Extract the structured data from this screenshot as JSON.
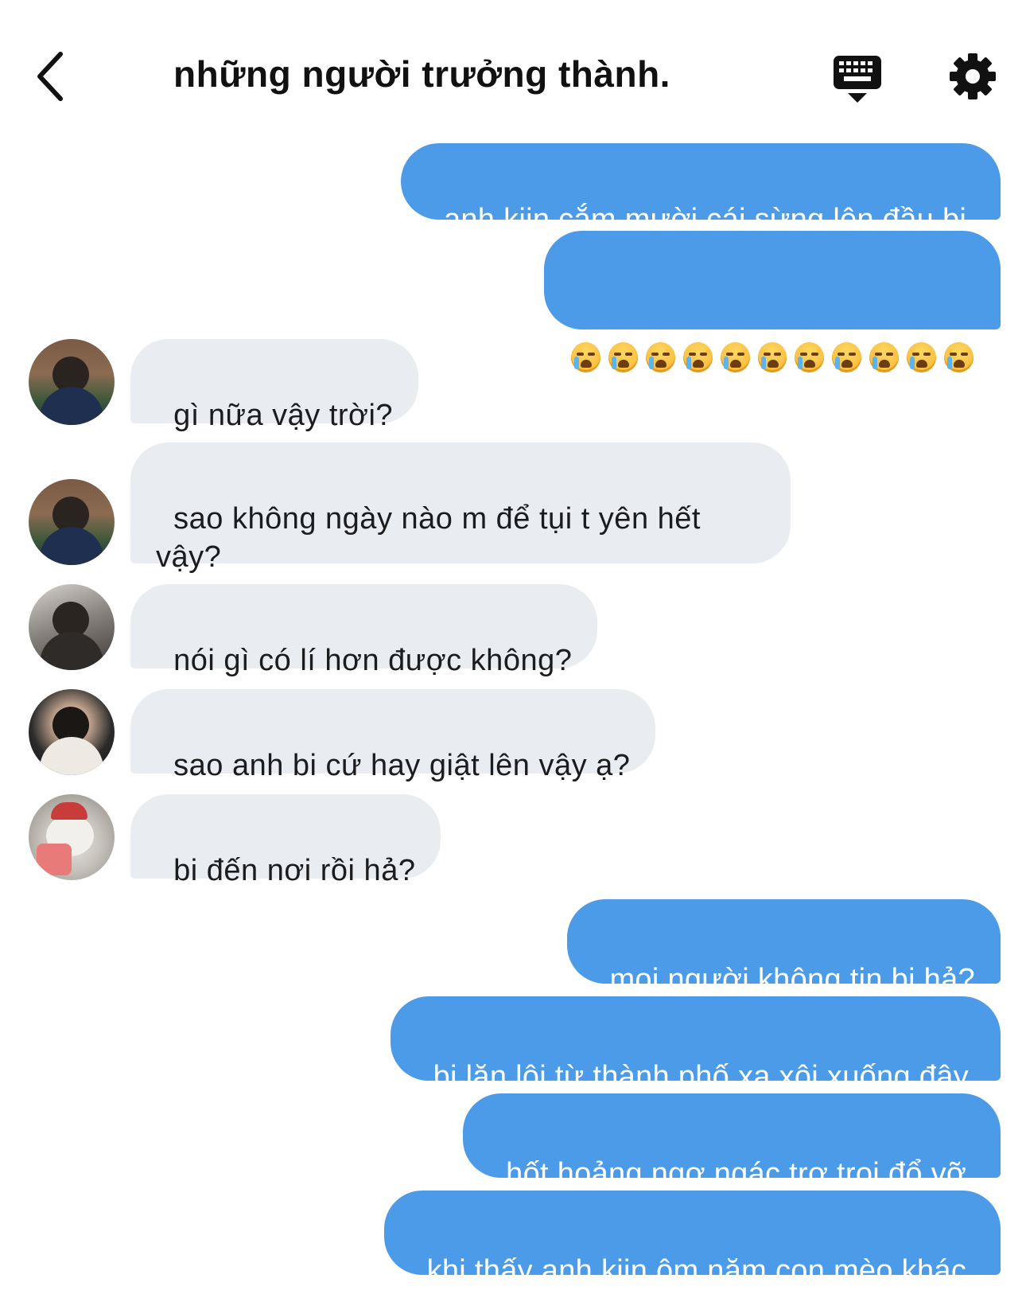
{
  "header": {
    "title": "những người trưởng thành."
  },
  "icons": {
    "back": "chevron-left-icon",
    "keyboard": "keyboard-icon",
    "settings": "gear-icon",
    "emoji": "loudly-crying-face-emoji"
  },
  "colors": {
    "outgoing_bubble": "#4c9be8",
    "incoming_bubble": "#e9edf1"
  },
  "messages": [
    {
      "direction": "out",
      "text": "anh kiin cắm mười cái sừng lên đầu bi."
    },
    {
      "direction": "out",
      "emoji": "😭",
      "emoji_count": 11
    },
    {
      "direction": "in",
      "text": "gì nữa vậy trời?"
    },
    {
      "direction": "in",
      "text": "sao không ngày nào m để tụi t yên hết vậy?"
    },
    {
      "direction": "in",
      "text": "nói gì có lí hơn được không?"
    },
    {
      "direction": "in",
      "text": "sao anh bi cứ hay giật lên vậy ạ?"
    },
    {
      "direction": "in",
      "text": "bi đến nơi rồi hả?"
    },
    {
      "direction": "out",
      "text": "mọi người không tin bi hả?"
    },
    {
      "direction": "out",
      "text": "bi lặn lội từ thành phố xa xôi xuống đây."
    },
    {
      "direction": "out",
      "text": "hốt hoảng ngơ ngác trơ trọi đổ vỡ."
    },
    {
      "direction": "out",
      "text": "khi thấy anh kiin ôm năm con mèo khác."
    }
  ]
}
